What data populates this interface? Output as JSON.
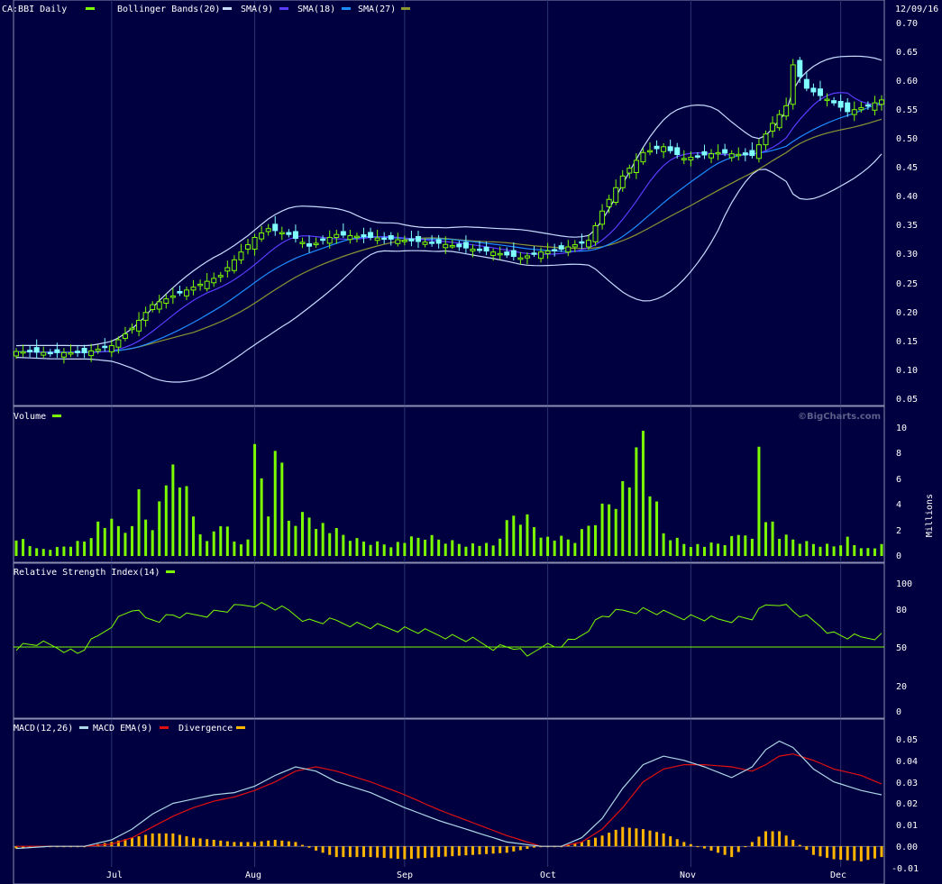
{
  "colors": {
    "background": "#000040",
    "grid": "#2c3570",
    "frame": "#8a8fb0",
    "text": "#ffffff",
    "candle_up": "#7CFC00",
    "candle_down": "#7fffff",
    "bollinger": "#c8dcff",
    "sma9": "#5a3cff",
    "sma18": "#1e8cff",
    "sma27": "#8c9632",
    "volume": "#7CFC00",
    "rsi": "#7CFC00",
    "macd": "#add8e6",
    "macd_ema": "#e01010",
    "divergence": "#ffb400"
  },
  "header": {
    "symbol_label": "CA:BBI Daily",
    "bb_label": "Bollinger Bands(20)",
    "sma9_label": "SMA(9)",
    "sma18_label": "SMA(18)",
    "sma27_label": "SMA(27)",
    "date": "12/09/16"
  },
  "watermark": "©BigCharts.com",
  "x_axis": {
    "months": [
      {
        "label": "Jul",
        "index": 14
      },
      {
        "label": "Aug",
        "index": 35
      },
      {
        "label": "Sep",
        "index": 57
      },
      {
        "label": "Oct",
        "index": 78
      },
      {
        "label": "Nov",
        "index": 99
      },
      {
        "label": "Dec",
        "index": 121
      }
    ],
    "num_days": 128
  },
  "price_panel": {
    "ylim": [
      0.05,
      0.7
    ],
    "ticks": [
      "0.70",
      "0.65",
      "0.60",
      "0.55",
      "0.50",
      "0.45",
      "0.40",
      "0.35",
      "0.30",
      "0.25",
      "0.20",
      "0.15",
      "0.10",
      "0.05"
    ]
  },
  "volume_panel": {
    "label": "Volume",
    "unit_label": "Millions",
    "ylim": [
      0,
      10
    ],
    "ticks": [
      "10",
      "8",
      "6",
      "4",
      "2",
      "0"
    ]
  },
  "rsi_panel": {
    "label": "Relative Strength Index(14)",
    "ylim": [
      0,
      100
    ],
    "ticks": [
      "100",
      "80",
      "50",
      "20",
      "0"
    ],
    "ref_line": 50
  },
  "macd_panel": {
    "label": "MACD(12,26)",
    "ema_label": "MACD EMA(9)",
    "div_label": "Divergence",
    "ylim": [
      -0.01,
      0.05
    ],
    "ticks": [
      "0.05",
      "0.04",
      "0.03",
      "0.02",
      "0.01",
      "0.00",
      "-0.01"
    ]
  },
  "chart_data": {
    "type": "line",
    "close_anchors": [
      [
        0,
        0.13
      ],
      [
        5,
        0.128
      ],
      [
        10,
        0.128
      ],
      [
        14,
        0.14
      ],
      [
        17,
        0.17
      ],
      [
        20,
        0.21
      ],
      [
        25,
        0.235
      ],
      [
        28,
        0.25
      ],
      [
        30,
        0.26
      ],
      [
        33,
        0.3
      ],
      [
        35,
        0.325
      ],
      [
        37,
        0.34
      ],
      [
        40,
        0.33
      ],
      [
        43,
        0.31
      ],
      [
        47,
        0.33
      ],
      [
        52,
        0.325
      ],
      [
        57,
        0.32
      ],
      [
        62,
        0.315
      ],
      [
        67,
        0.305
      ],
      [
        70,
        0.3
      ],
      [
        74,
        0.29
      ],
      [
        77,
        0.3
      ],
      [
        80,
        0.305
      ],
      [
        84,
        0.32
      ],
      [
        86,
        0.37
      ],
      [
        89,
        0.43
      ],
      [
        92,
        0.47
      ],
      [
        95,
        0.48
      ],
      [
        98,
        0.46
      ],
      [
        103,
        0.47
      ],
      [
        108,
        0.465
      ],
      [
        111,
        0.52
      ],
      [
        113,
        0.55
      ],
      [
        114,
        0.62
      ],
      [
        116,
        0.58
      ],
      [
        120,
        0.555
      ],
      [
        122,
        0.54
      ],
      [
        125,
        0.55
      ],
      [
        127,
        0.56
      ]
    ],
    "volume_anchors": [
      [
        0,
        1.6
      ],
      [
        3,
        0.5
      ],
      [
        6,
        0.6
      ],
      [
        10,
        1.2
      ],
      [
        12,
        2.5
      ],
      [
        14,
        2.4
      ],
      [
        17,
        2.0
      ],
      [
        18,
        5.3
      ],
      [
        20,
        1.8
      ],
      [
        22,
        7.3
      ],
      [
        24,
        6.0
      ],
      [
        26,
        3.0
      ],
      [
        28,
        1.0
      ],
      [
        30,
        2.9
      ],
      [
        32,
        1.2
      ],
      [
        34,
        1.2
      ],
      [
        35,
        9.8
      ],
      [
        36,
        5.0
      ],
      [
        37,
        3.0
      ],
      [
        38,
        9.7
      ],
      [
        40,
        2.8
      ],
      [
        43,
        3.2
      ],
      [
        46,
        2.0
      ],
      [
        50,
        1.2
      ],
      [
        55,
        0.9
      ],
      [
        60,
        1.5
      ],
      [
        65,
        1.0
      ],
      [
        70,
        0.8
      ],
      [
        73,
        3.2
      ],
      [
        75,
        2.9
      ],
      [
        78,
        1.4
      ],
      [
        82,
        1.2
      ],
      [
        85,
        3.0
      ],
      [
        87,
        4.3
      ],
      [
        90,
        6.0
      ],
      [
        91,
        7.0
      ],
      [
        92,
        9.5
      ],
      [
        93,
        5.5
      ],
      [
        95,
        1.8
      ],
      [
        98,
        1.0
      ],
      [
        101,
        0.8
      ],
      [
        104,
        1.0
      ],
      [
        107,
        2.0
      ],
      [
        108,
        1.2
      ],
      [
        109,
        9.1
      ],
      [
        110,
        3.5
      ],
      [
        112,
        1.5
      ],
      [
        116,
        1.0
      ],
      [
        120,
        0.8
      ],
      [
        122,
        1.4
      ],
      [
        124,
        0.5
      ],
      [
        127,
        0.8
      ]
    ],
    "rsi_anchors": [
      [
        0,
        50
      ],
      [
        3,
        53
      ],
      [
        6,
        50
      ],
      [
        9,
        45
      ],
      [
        12,
        58
      ],
      [
        14,
        68
      ],
      [
        17,
        80
      ],
      [
        19,
        72
      ],
      [
        21,
        72
      ],
      [
        23,
        75
      ],
      [
        25,
        74
      ],
      [
        28,
        76
      ],
      [
        31,
        79
      ],
      [
        33,
        82
      ],
      [
        35,
        84
      ],
      [
        37,
        82
      ],
      [
        40,
        78
      ],
      [
        43,
        70
      ],
      [
        47,
        70
      ],
      [
        52,
        66
      ],
      [
        57,
        64
      ],
      [
        62,
        60
      ],
      [
        67,
        55
      ],
      [
        70,
        50
      ],
      [
        73,
        50
      ],
      [
        75,
        42
      ],
      [
        77,
        52
      ],
      [
        79,
        50
      ],
      [
        82,
        55
      ],
      [
        84,
        65
      ],
      [
        86,
        74
      ],
      [
        89,
        78
      ],
      [
        92,
        79
      ],
      [
        95,
        76
      ],
      [
        98,
        74
      ],
      [
        103,
        71
      ],
      [
        108,
        73
      ],
      [
        110,
        82
      ],
      [
        112,
        85
      ],
      [
        114,
        78
      ],
      [
        118,
        67
      ],
      [
        120,
        60
      ],
      [
        122,
        58
      ],
      [
        124,
        57
      ],
      [
        127,
        59
      ]
    ],
    "macd_anchors": [
      [
        0,
        -0.001
      ],
      [
        5,
        0.0
      ],
      [
        10,
        0.0
      ],
      [
        14,
        0.003
      ],
      [
        17,
        0.008
      ],
      [
        20,
        0.015
      ],
      [
        23,
        0.02
      ],
      [
        26,
        0.022
      ],
      [
        29,
        0.024
      ],
      [
        32,
        0.025
      ],
      [
        35,
        0.028
      ],
      [
        38,
        0.033
      ],
      [
        41,
        0.037
      ],
      [
        44,
        0.035
      ],
      [
        47,
        0.03
      ],
      [
        52,
        0.025
      ],
      [
        57,
        0.018
      ],
      [
        62,
        0.012
      ],
      [
        67,
        0.007
      ],
      [
        72,
        0.002
      ],
      [
        77,
        0.0
      ],
      [
        80,
        0.0
      ],
      [
        83,
        0.004
      ],
      [
        86,
        0.013
      ],
      [
        89,
        0.027
      ],
      [
        92,
        0.038
      ],
      [
        95,
        0.042
      ],
      [
        98,
        0.04
      ],
      [
        101,
        0.037
      ],
      [
        105,
        0.032
      ],
      [
        108,
        0.037
      ],
      [
        110,
        0.045
      ],
      [
        112,
        0.049
      ],
      [
        114,
        0.046
      ],
      [
        117,
        0.036
      ],
      [
        120,
        0.03
      ],
      [
        124,
        0.026
      ],
      [
        127,
        0.024
      ]
    ],
    "ema_anchors": [
      [
        0,
        0.0
      ],
      [
        5,
        0.0
      ],
      [
        10,
        0.0
      ],
      [
        14,
        0.001
      ],
      [
        17,
        0.004
      ],
      [
        20,
        0.009
      ],
      [
        23,
        0.014
      ],
      [
        26,
        0.018
      ],
      [
        29,
        0.021
      ],
      [
        32,
        0.023
      ],
      [
        35,
        0.026
      ],
      [
        38,
        0.03
      ],
      [
        41,
        0.035
      ],
      [
        44,
        0.037
      ],
      [
        47,
        0.035
      ],
      [
        52,
        0.03
      ],
      [
        57,
        0.024
      ],
      [
        62,
        0.017
      ],
      [
        67,
        0.011
      ],
      [
        72,
        0.005
      ],
      [
        77,
        0.0
      ],
      [
        80,
        0.0
      ],
      [
        83,
        0.002
      ],
      [
        86,
        0.008
      ],
      [
        89,
        0.018
      ],
      [
        92,
        0.03
      ],
      [
        95,
        0.036
      ],
      [
        98,
        0.038
      ],
      [
        101,
        0.038
      ],
      [
        105,
        0.037
      ],
      [
        108,
        0.035
      ],
      [
        110,
        0.038
      ],
      [
        112,
        0.042
      ],
      [
        114,
        0.043
      ],
      [
        117,
        0.04
      ],
      [
        120,
        0.036
      ],
      [
        124,
        0.033
      ],
      [
        127,
        0.029
      ]
    ]
  }
}
